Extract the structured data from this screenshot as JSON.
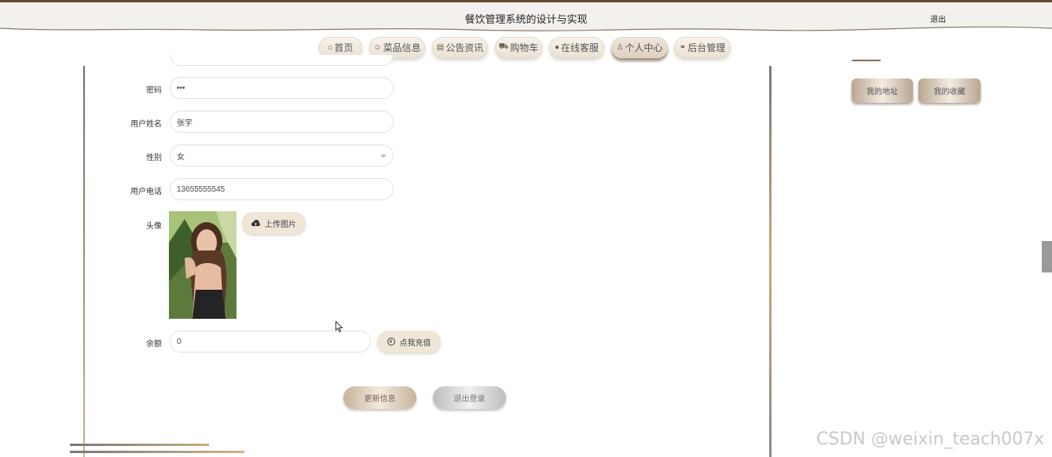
{
  "header": {
    "title": "餐饮管理系统的设计与实现",
    "logout": "退出"
  },
  "nav": [
    {
      "label": "首页",
      "icon": "home-icon",
      "glyph": "⌂"
    },
    {
      "label": "菜品信息",
      "icon": "dish-icon",
      "glyph": "☺"
    },
    {
      "label": "公告资讯",
      "icon": "notice-icon",
      "glyph": "▤"
    },
    {
      "label": "购物车",
      "icon": "cart-icon",
      "glyph": "🛒"
    },
    {
      "label": "在线客服",
      "icon": "chat-icon",
      "glyph": "●"
    },
    {
      "label": "个人中心",
      "icon": "user-icon",
      "glyph": "♙",
      "active": true
    },
    {
      "label": "后台管理",
      "icon": "link-icon",
      "glyph": "⚭"
    }
  ],
  "form": {
    "password": {
      "label": "密码",
      "value": "•••"
    },
    "name": {
      "label": "用户姓名",
      "value": "张宇"
    },
    "gender": {
      "label": "性别",
      "value": "女"
    },
    "phone": {
      "label": "用户电话",
      "value": "13655555545"
    },
    "avatar": {
      "label": "头像",
      "upload_label": "上传图片"
    },
    "balance": {
      "label": "余额",
      "value": "0",
      "recharge_label": "点我充值"
    }
  },
  "actions": {
    "update": "更新信息",
    "logout": "退出登录"
  },
  "side": {
    "address": "我的地址",
    "favorites": "我的收藏"
  },
  "watermark": "CSDN @weixin_teach007x",
  "colors": {
    "accent": "#6b4a2f",
    "button_light": "#efe6d8"
  }
}
